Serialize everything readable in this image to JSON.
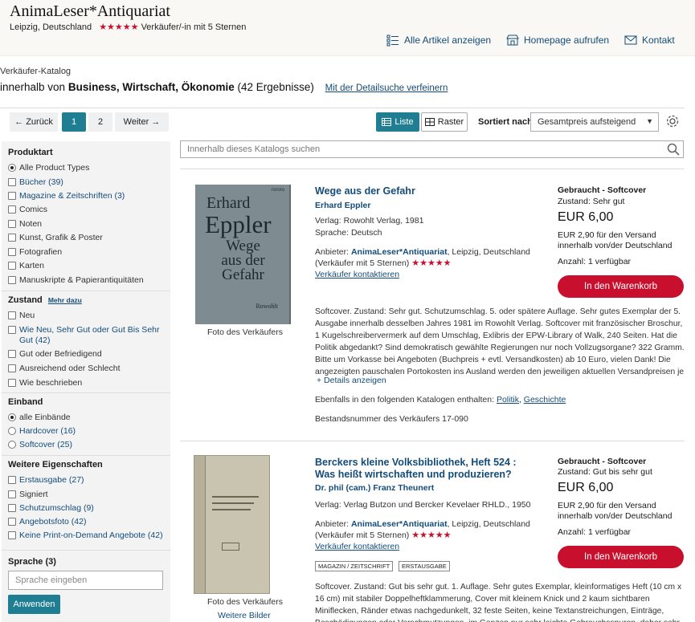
{
  "header": {
    "seller_name": "AnimaLeser*Antiquariat",
    "location": "Leipzig, Deutschland",
    "stars": "★★★★★",
    "rating_text": "Verkäufer/-in mit 5 Sternen",
    "links": {
      "all_items": "Alle Artikel anzeigen",
      "homepage": "Homepage aufrufen",
      "contact": "Kontakt"
    }
  },
  "catalog": {
    "label": "Verkäufer-Katalog",
    "title_prefix": "innerhalb von",
    "title_bold": "Business, Wirtschaft, Ökonomie",
    "count": "(42 Ergebnisse)",
    "refine": "Mit der Detailsuche verfeinern"
  },
  "pagination": {
    "back": "← Zurück",
    "pages": [
      "1",
      "2"
    ],
    "next": "Weiter →"
  },
  "view": {
    "list": "Liste",
    "grid": "Raster"
  },
  "sort": {
    "label": "Sortiert nach",
    "value": "Gesamtpreis aufsteigend"
  },
  "search": {
    "placeholder": "Innerhalb dieses Katalogs suchen"
  },
  "sidebar": {
    "product_type": {
      "heading": "Produktart",
      "items": [
        "Alle Product Types",
        "Bücher (39)",
        "Magazine & Zeitschriften (3)",
        "Comics",
        "Noten",
        "Kunst, Grafik & Poster",
        "Fotografien",
        "Karten",
        "Manuskripte & Papierantiquitäten"
      ]
    },
    "condition": {
      "heading": "Zustand",
      "more": "Mehr dazu",
      "items": [
        "Neu",
        "Wie Neu, Sehr Gut oder Gut Bis Sehr Gut (42)",
        "Gut oder Befriedigend",
        "Ausreichend oder Schlecht",
        "Wie beschrieben"
      ]
    },
    "binding": {
      "heading": "Einband",
      "items": [
        "alle Einbände",
        "Hardcover (16)",
        "Softcover (25)"
      ]
    },
    "attributes": {
      "heading": "Weitere Eigenschaften",
      "items": [
        "Erstausgabe (27)",
        "Signiert",
        "Schutzumschlag (9)",
        "Angebotsfoto (42)",
        "Keine Print-on-Demand Angebote (42)"
      ]
    },
    "language": {
      "heading": "Sprache (3)",
      "placeholder": "Sprache eingeben",
      "apply": "Anwenden"
    }
  },
  "listings": [
    {
      "title": "Wege aus der Gefahr",
      "author": "Erhard Eppler",
      "publisher": "Verlag: Rowohlt Verlag, 1981",
      "language": "Sprache: Deutsch",
      "seller_prefix": "Anbieter: ",
      "seller": "AnimaLeser*Antiquariat",
      "seller_loc": ", Leipzig, Deutschland",
      "seller_rating": "(Verkäufer mit 5 Sternen)",
      "contact": "Verkäufer kontaktieren",
      "photo_caption": "Foto des Verkäufers",
      "cover_author": "Erhard",
      "cover_surname": "Eppler",
      "cover_title_1": "Wege",
      "cover_title_2": "aus der",
      "cover_title_3": "Gefahr",
      "cover_brand": "Rowohlt",
      "cover_corner": "rororo",
      "binding": "Gebraucht - Softcover",
      "condition": "Zustand: Sehr gut",
      "price": "EUR 6,00",
      "shipping": "EUR 2,90 für den Versand innerhalb von/der Deutschland",
      "quantity": "Anzahl: 1 verfügbar",
      "cart": "In den Warenkorb",
      "description": "Softcover. Zustand: Sehr gut. Schutzumschlag. 5. oder spätere Auflage. Sehr gutes Exemplar der 5. Ausgabe innerhalb desselben Jahres 1981 im Rowohlt Verlag. Softcover mit französischer Broschur, 1 Kugelschreibervermerk auf dem Umschlag, Exlibris der EPW-Library of Walk, 240 Seiten. Hat die Politik abgedankt? Sind demokratisch gewählte Regierungen nur noch Vollzugsorgane? 322 Gramm. Bitte um Vorkasse bei Angeboten (Buchpreis + evtl. Versandkosten) ab 10 Euro, vielen Dank! Die angezeigten pauschalen Portokosten ins Ausland werden den jeweiligen aktuellen Versandpreisen je nach Gewicht...",
      "details": "+ Details anzeigen",
      "also_in": "Ebenfalls in den folgenden Katalogen enthalten:",
      "catalogs": [
        "Politik",
        "Geschichte"
      ],
      "stock": "Bestandsnummer des Verkäufers 17-090"
    },
    {
      "title": "Berckers kleine Volksbibliothek, Heft 524 : Was heißt wirtschaften und produzieren?",
      "author": "Dr. phil (cam.) Franz Theunert",
      "publisher": "Verlag: Verlag Butzon und Bercker Kevelaer RHLD., 1950",
      "seller_prefix": "Anbieter: ",
      "seller": "AnimaLeser*Antiquariat",
      "seller_loc": ", Leipzig, Deutschland",
      "seller_rating": "(Verkäufer mit 5 Sternen)",
      "contact": "Verkäufer kontaktieren",
      "tags": [
        "MAGAZIN / ZEITSCHRIFT",
        "ERSTAUSGABE"
      ],
      "photo_caption": "Foto des Verkäufers",
      "more_images": "Weitere Bilder",
      "binding": "Gebraucht - Softcover",
      "condition": "Zustand: Gut bis sehr gut",
      "price": "EUR 6,00",
      "shipping": "EUR 2,90 für den Versand innerhalb von/der Deutschland",
      "quantity": "Anzahl: 1 verfügbar",
      "cart": "In den Warenkorb",
      "description": "Softcover. Zustand: Gut bis sehr gut. 1. Auflage. Sehr gutes Exemplar, kleinformatiges Heft (10 cm x 16 cm) mit stabiler Doppelheftklammerung, Cover mit kleinem Knick und 2 kaum sichtbaren Miniflecken, Ränder etwas nachgedunkelt, 32 feste Seiten, keine Textanstreichungen, Einträge, Beschädigungen oder Verschmutzungen, im Ganzen nur sehr leichte Gebrauchsspuren, daher sehr gut als antiquarisches"
    }
  ],
  "colors": {
    "accent": "#1f7e92",
    "cart": "#c8102e",
    "link": "#134c7a",
    "stars": "#c8102e"
  }
}
